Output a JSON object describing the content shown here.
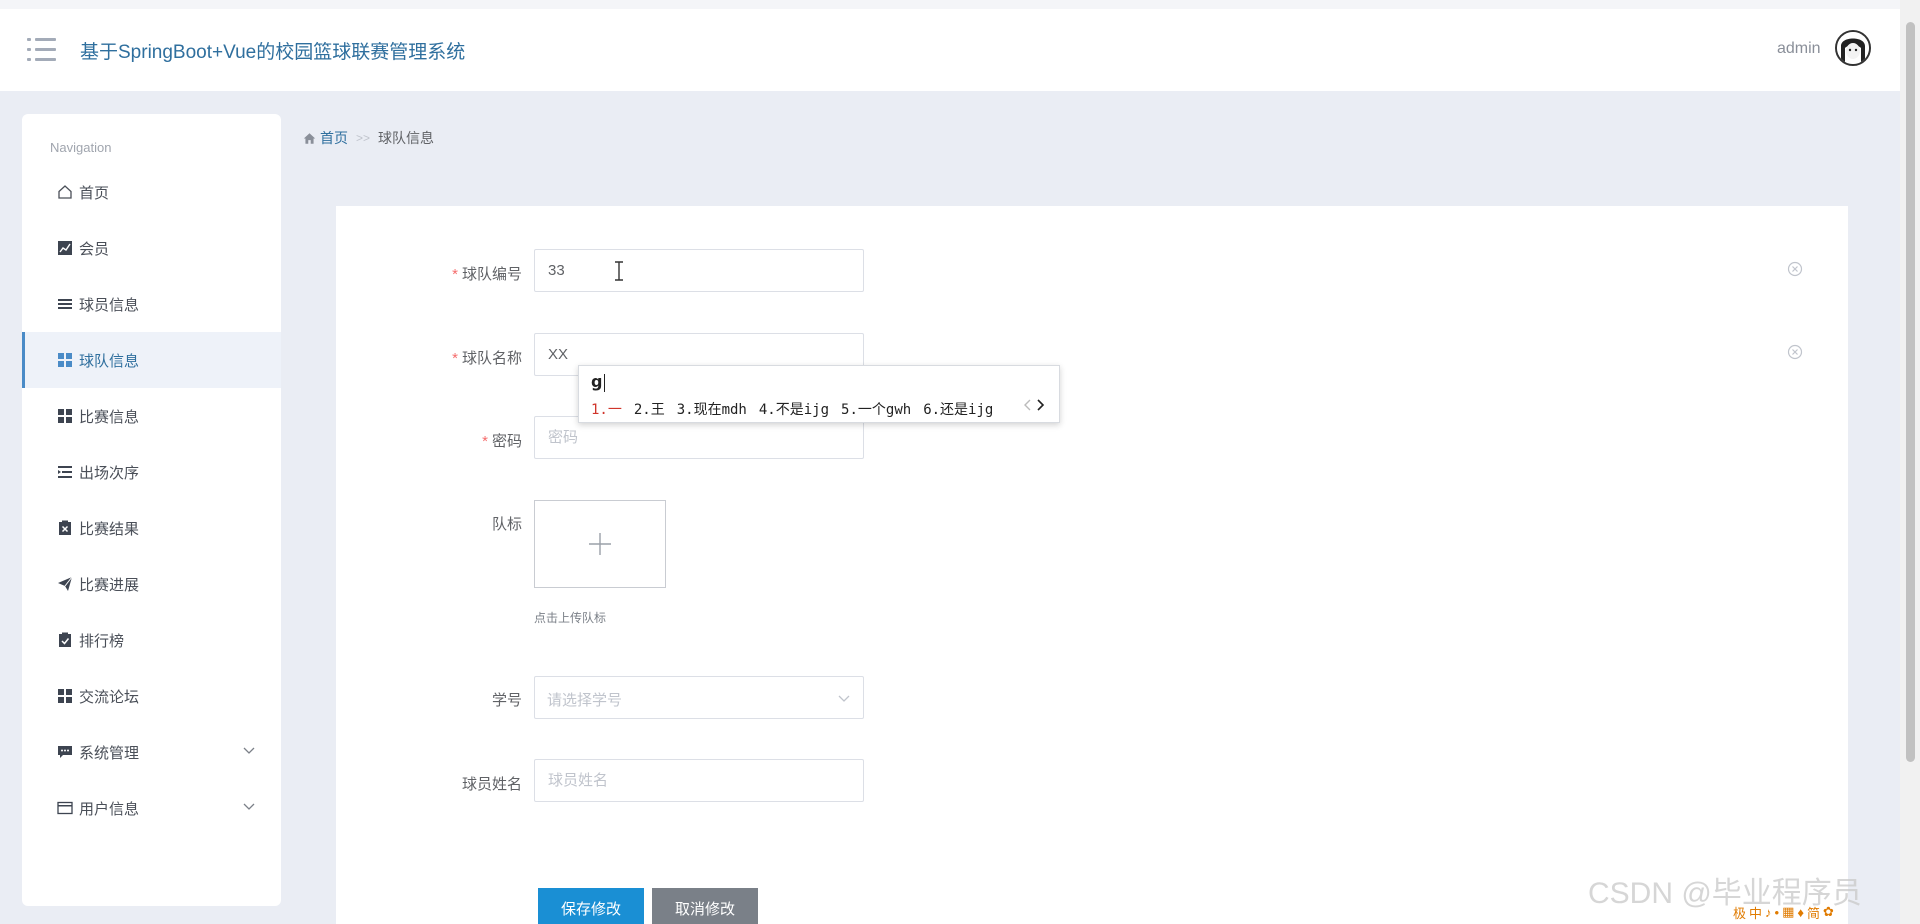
{
  "header": {
    "title": "基于SpringBoot+Vue的校园篮球联赛管理系统",
    "username": "admin"
  },
  "sidebar": {
    "heading": "Navigation",
    "items": [
      {
        "label": "首页",
        "icon": "home-icon"
      },
      {
        "label": "会员",
        "icon": "chart-icon"
      },
      {
        "label": "球员信息",
        "icon": "list-icon"
      },
      {
        "label": "球队信息",
        "icon": "grid-icon",
        "active": true
      },
      {
        "label": "比赛信息",
        "icon": "grid-icon"
      },
      {
        "label": "出场次序",
        "icon": "indent-icon"
      },
      {
        "label": "比赛结果",
        "icon": "clipboard-x-icon"
      },
      {
        "label": "比赛进展",
        "icon": "send-icon"
      },
      {
        "label": "排行榜",
        "icon": "clipboard-check-icon"
      },
      {
        "label": "交流论坛",
        "icon": "grid-icon"
      },
      {
        "label": "系统管理",
        "icon": "comment-icon",
        "expandable": true
      },
      {
        "label": "用户信息",
        "icon": "card-icon",
        "expandable": true
      }
    ]
  },
  "breadcrumb": {
    "home": "首页",
    "separator": ">>",
    "current": "球队信息"
  },
  "form": {
    "team_no_label": "球队编号",
    "team_no_value": "33",
    "team_name_label": "球队名称",
    "team_name_value": "XX",
    "password_label": "密码",
    "password_placeholder": "密码",
    "logo_label": "队标",
    "logo_tip": "点击上传队标",
    "student_no_label": "学号",
    "student_no_placeholder": "请选择学号",
    "player_name_label": "球员姓名",
    "player_name_placeholder": "球员姓名",
    "save_label": "保存修改",
    "cancel_label": "取消修改"
  },
  "ime": {
    "composition": "g",
    "candidates": [
      "1.一",
      "2.王",
      "3.现在mdh",
      "4.不是ijg",
      "5.一个gwh",
      "6.还是ijg"
    ]
  },
  "watermark": "CSDN @毕业程序员",
  "tray": [
    "极",
    "中",
    "♪",
    "•",
    "▦",
    "♦",
    "简",
    "✿"
  ]
}
